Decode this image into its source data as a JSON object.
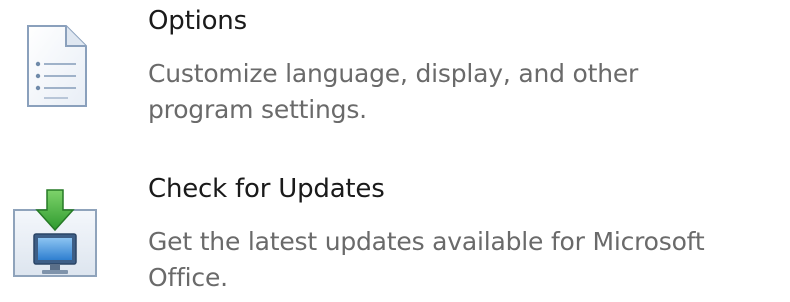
{
  "items": [
    {
      "id": "options",
      "icon": "options-document-icon",
      "title": "Options",
      "description_line1": "Customize language, display, and other",
      "description_line2": "program settings."
    },
    {
      "id": "check-for-updates",
      "icon": "check-for-updates-icon",
      "title": "Check for Updates",
      "description_line1": "Get the latest updates available for Microsoft",
      "description_line2": "Office."
    }
  ],
  "colors": {
    "title": "#1a1a1a",
    "description": "#6a6a6a",
    "accent_blue": "#4a8fd6",
    "accent_green": "#3aa83a"
  }
}
